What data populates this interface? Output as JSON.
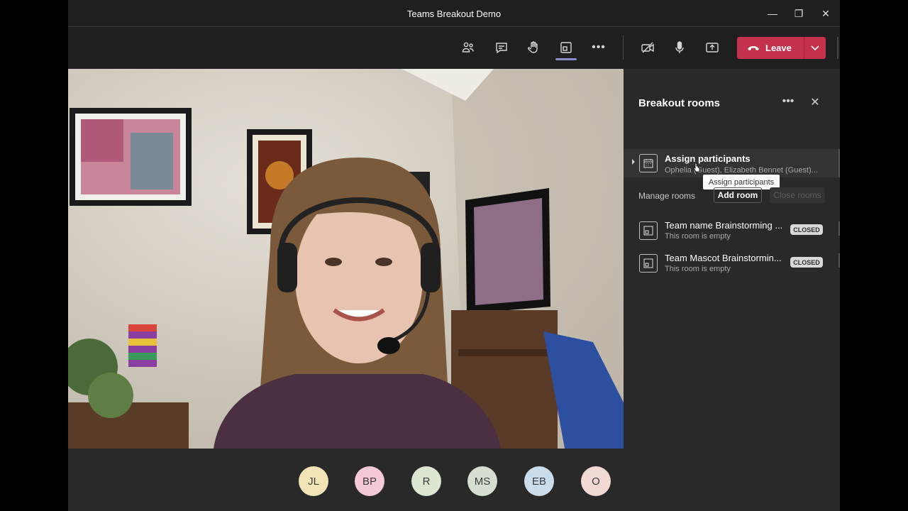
{
  "window": {
    "title": "Teams Breakout Demo",
    "controls": {
      "minimize": "—",
      "restore": "❐",
      "close": "✕"
    }
  },
  "toolbar": {
    "leave_label": "Leave",
    "icons": [
      "people-icon",
      "chat-icon",
      "raise-hand-icon",
      "breakout-rooms-icon",
      "more-icon",
      "camera-off-icon",
      "microphone-icon",
      "share-icon"
    ],
    "accent": "#8b8cc7",
    "leave_color": "#c4314b"
  },
  "participants": [
    {
      "initials": "JL",
      "color": "#f3e4b8"
    },
    {
      "initials": "BP",
      "color": "#f5c9d6"
    },
    {
      "initials": "R",
      "color": "#dde6d0"
    },
    {
      "initials": "MS",
      "color": "#d5ded1"
    },
    {
      "initials": "EB",
      "color": "#cbdcea"
    },
    {
      "initials": "O",
      "color": "#f3d9d4"
    }
  ],
  "panel": {
    "title": "Breakout rooms",
    "more": "•••",
    "close": "✕",
    "assign": {
      "title": "Assign participants",
      "subtitle": "Ophelia (Guest), Elizabeth Bennet (Guest)..."
    },
    "tooltip": "Assign participants",
    "manage_label": "Manage rooms",
    "add_room": "Add room",
    "close_rooms": "Close rooms",
    "rooms": [
      {
        "name": "Team name Brainstorming ...",
        "status": "This room is empty",
        "badge": "CLOSED"
      },
      {
        "name": "Team Mascot Brainstormin...",
        "status": "This room is empty",
        "badge": "CLOSED"
      }
    ]
  }
}
